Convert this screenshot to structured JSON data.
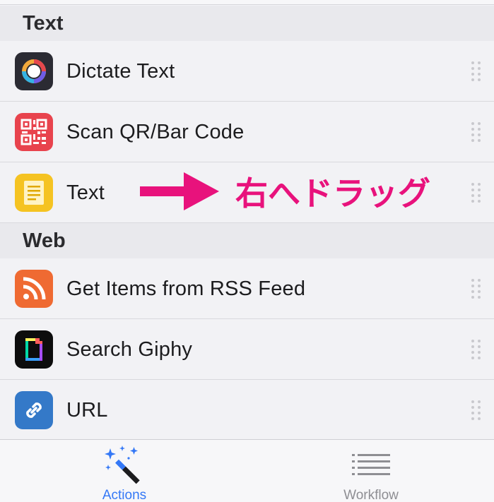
{
  "sections": [
    {
      "title": "Text"
    },
    {
      "title": "Web"
    }
  ],
  "rows": [
    {
      "label": "Dictate Text",
      "icon": "dictate-icon"
    },
    {
      "label": "Scan QR/Bar Code",
      "icon": "qr-code-icon"
    },
    {
      "label": "Text",
      "icon": "text-note-icon"
    },
    {
      "label": "Get Items from RSS Feed",
      "icon": "rss-icon"
    },
    {
      "label": "Search Giphy",
      "icon": "giphy-icon"
    },
    {
      "label": "URL",
      "icon": "link-icon"
    }
  ],
  "annotation": {
    "text": "右へドラッグ",
    "color": "#e8127c"
  },
  "tabs": [
    {
      "label": "Actions",
      "icon": "magic-wand-icon",
      "active": true
    },
    {
      "label": "Workflow",
      "icon": "list-icon",
      "active": false
    }
  ],
  "colors": {
    "accent": "#3478f6",
    "annotation": "#e8127c",
    "inactive_tab": "#8e8e93"
  }
}
